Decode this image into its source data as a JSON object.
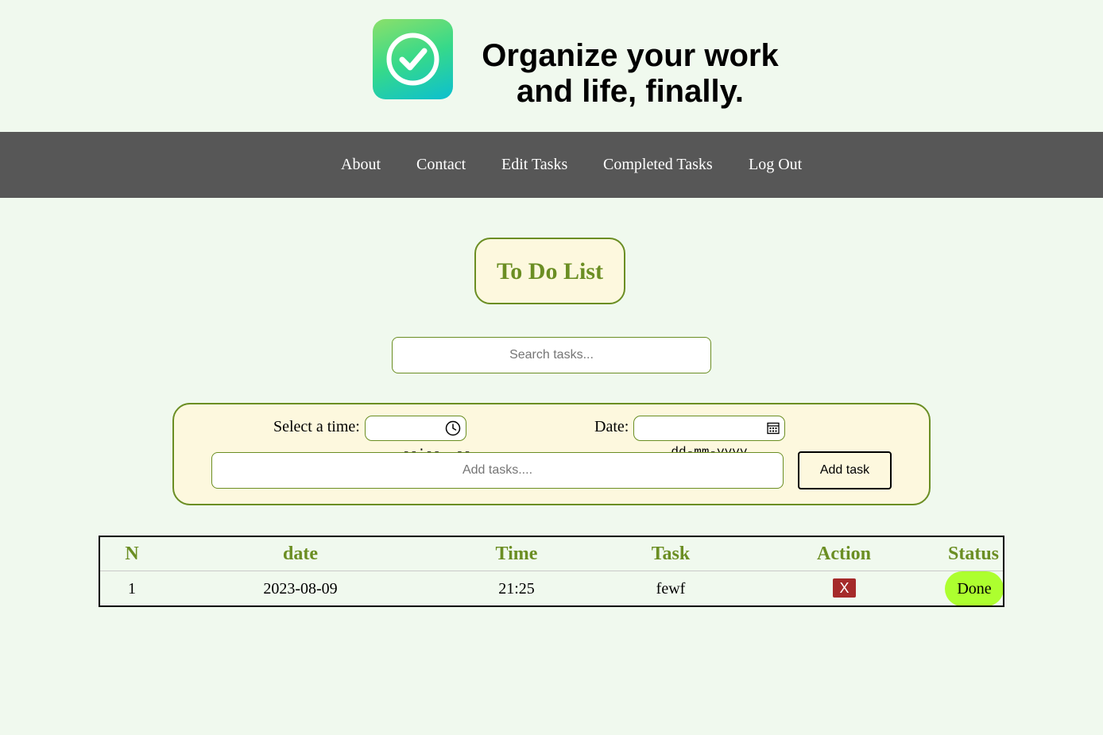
{
  "header": {
    "logo_icon": "check-circle-icon",
    "headline_line1": "Organize your work",
    "headline_line2": "and life, finally."
  },
  "nav": {
    "items": [
      {
        "label": "About"
      },
      {
        "label": "Contact"
      },
      {
        "label": "Edit Tasks"
      },
      {
        "label": "Completed Tasks"
      },
      {
        "label": "Log Out"
      }
    ]
  },
  "main": {
    "title": "To Do List",
    "search_placeholder": "Search tasks..."
  },
  "form": {
    "time_label": "Select a time:",
    "time_value": "--:--  --",
    "date_label": "Date:",
    "date_value": "dd-mm-yyyy",
    "task_placeholder": "Add tasks....",
    "add_button": "Add task"
  },
  "table": {
    "headers": [
      "N",
      "date",
      "Time",
      "Task",
      "Action",
      "Status"
    ],
    "rows": [
      {
        "n": "1",
        "date": "2023-08-09",
        "time": "21:25",
        "task": "fewf",
        "action": "X",
        "status": "Done"
      }
    ]
  },
  "colors": {
    "background": "#f0f9ee",
    "navbar": "#575757",
    "accent": "#6b8e23",
    "panel": "#fdf8de",
    "delete": "#a52a2a",
    "done": "#adff2f"
  }
}
